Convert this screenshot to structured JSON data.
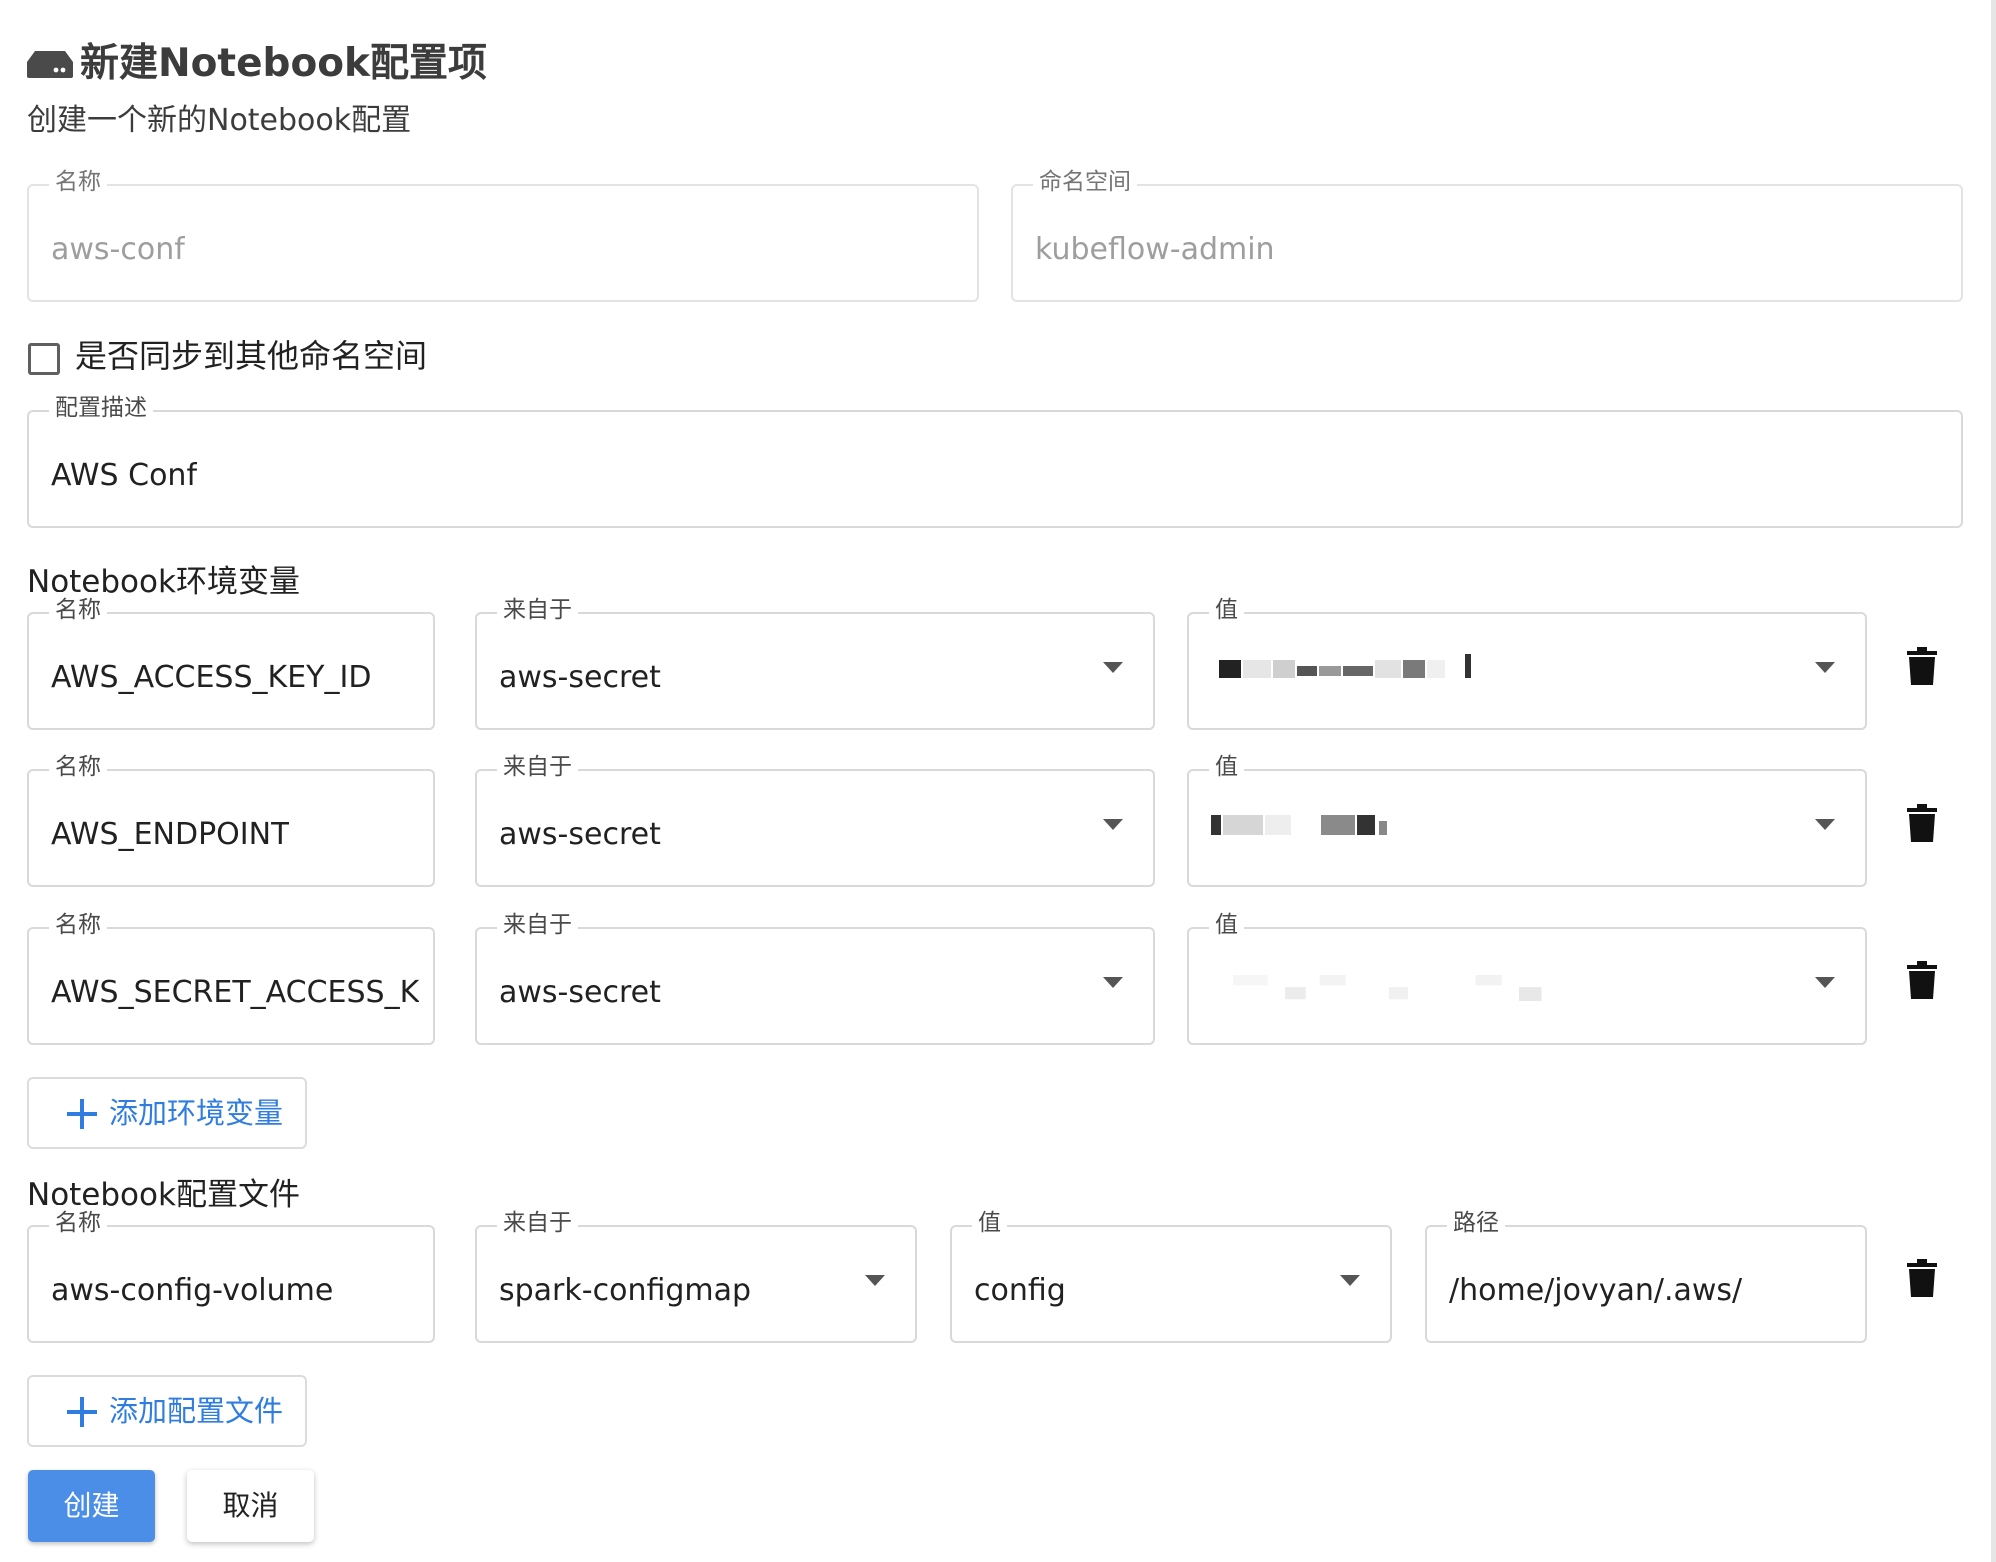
{
  "header": {
    "icon": "storage-drive-icon",
    "title": "新建Notebook配置项",
    "subtitle": "创建一个新的Notebook配置"
  },
  "basic": {
    "name_label": "名称",
    "name_value": "aws-conf",
    "namespace_label": "命名空间",
    "namespace_value": "kubeflow-admin"
  },
  "sync": {
    "label": "是否同步到其他命名空间",
    "checked": false
  },
  "description": {
    "label": "配置描述",
    "value": "AWS Conf"
  },
  "env_section": {
    "title": "Notebook环境变量",
    "rows": [
      {
        "name_label": "名称",
        "name": "AWS_ACCESS_KEY_ID",
        "from_label": "来自于",
        "from": "aws-secret",
        "value_label": "值",
        "value": ""
      },
      {
        "name_label": "名称",
        "name": "AWS_ENDPOINT",
        "from_label": "来自于",
        "from": "aws-secret",
        "value_label": "值",
        "value": ""
      },
      {
        "name_label": "名称",
        "name": "AWS_SECRET_ACCESS_K",
        "from_label": "来自于",
        "from": "aws-secret",
        "value_label": "值",
        "value": ""
      }
    ],
    "add_label": "添加环境变量"
  },
  "file_section": {
    "title": "Notebook配置文件",
    "rows": [
      {
        "name_label": "名称",
        "name": "aws-config-volume",
        "from_label": "来自于",
        "from": "spark-configmap",
        "value_label": "值",
        "value": "config",
        "path_label": "路径",
        "path": "/home/jovyan/.aws/"
      }
    ],
    "add_label": "添加配置文件"
  },
  "actions": {
    "create": "创建",
    "cancel": "取消"
  },
  "colors": {
    "primary": "#4a8ee8",
    "link": "#2f7de1"
  }
}
